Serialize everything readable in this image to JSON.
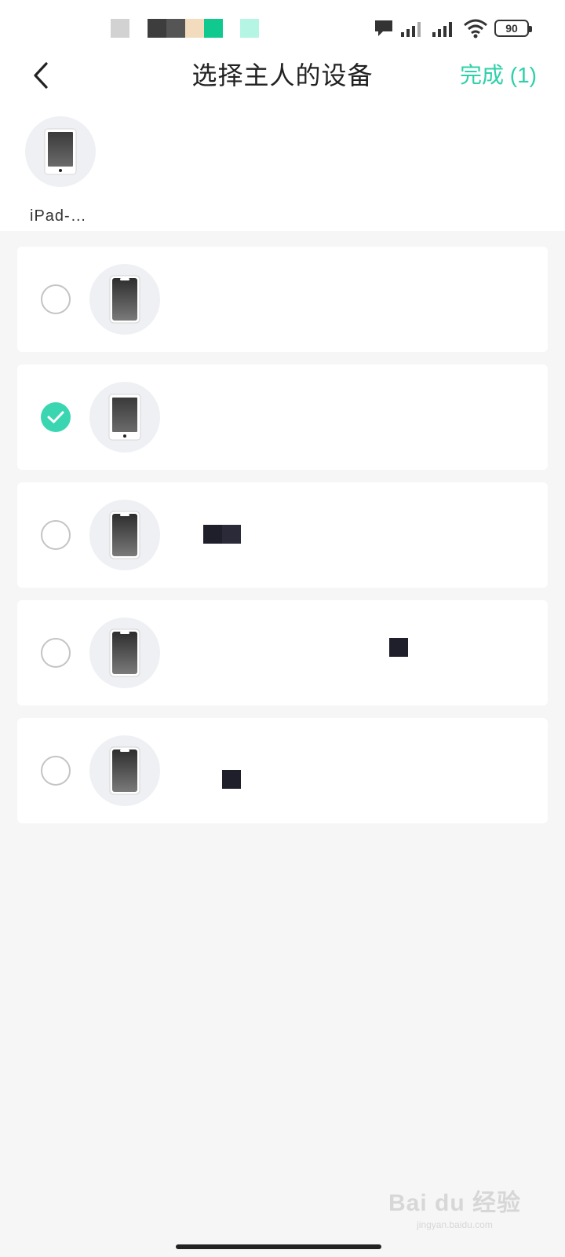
{
  "status_bar": {
    "battery_level": "90",
    "icons": [
      "message-icon",
      "signal-icon",
      "signal-icon",
      "wifi-icon",
      "battery-icon"
    ]
  },
  "header": {
    "back_icon": "chevron-left-icon",
    "title": "选择主人的设备",
    "done_label": "完成 (1)",
    "accent_color": "#2fd0aa"
  },
  "selected": {
    "items": [
      {
        "label": "iPad-…",
        "icon": "tablet-icon"
      }
    ]
  },
  "devices": [
    {
      "checked": false,
      "icon": "phone-icon"
    },
    {
      "checked": true,
      "icon": "tablet-icon"
    },
    {
      "checked": false,
      "icon": "phone-icon"
    },
    {
      "checked": false,
      "icon": "phone-icon"
    },
    {
      "checked": false,
      "icon": "phone-icon"
    }
  ],
  "colors": {
    "background": "#f6f6f7",
    "check": "#3ad6b1",
    "radio_border": "#c4c4c4"
  }
}
